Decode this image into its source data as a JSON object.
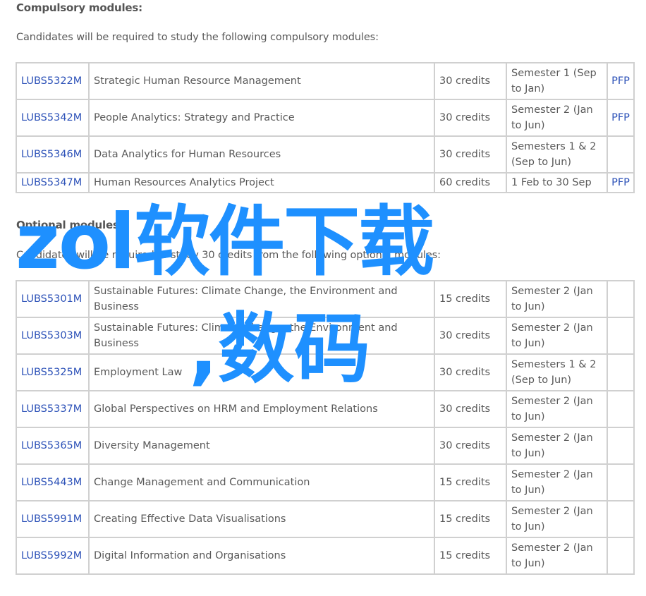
{
  "compulsory": {
    "heading": "Compulsory modules:",
    "intro": "Candidates will be required to study the following compulsory modules:",
    "rows": [
      {
        "code": "LUBS5322M",
        "title": "Strategic Human Resource Management",
        "credits": "30 credits",
        "semester": "Semester 1 (Sep to Jan)",
        "pfp": "PFP"
      },
      {
        "code": "LUBS5342M",
        "title": "People Analytics: Strategy and Practice",
        "credits": "30 credits",
        "semester": "Semester 2 (Jan to Jun)",
        "pfp": "PFP"
      },
      {
        "code": "LUBS5346M",
        "title": "Data Analytics for Human Resources",
        "credits": "30 credits",
        "semester": "Semesters 1 & 2 (Sep to Jun)",
        "pfp": ""
      },
      {
        "code": "LUBS5347M",
        "title": "Human Resources Analytics Project",
        "credits": "60 credits",
        "semester": "1 Feb to 30 Sep",
        "pfp": "PFP"
      }
    ]
  },
  "optional": {
    "heading": "Optional modules:",
    "intro": "Candidates will be required to study 30 credits from the following optional modules:",
    "rows": [
      {
        "code": "LUBS5301M",
        "title": "Sustainable Futures: Climate Change, the Environment and Business",
        "credits": "15 credits",
        "semester": "Semester 2 (Jan to Jun)",
        "pfp": ""
      },
      {
        "code": "LUBS5303M",
        "title": "Sustainable Futures: Climate Change, the Environment and Business",
        "credits": "30 credits",
        "semester": "Semester 2 (Jan to Jun)",
        "pfp": ""
      },
      {
        "code": "LUBS5325M",
        "title": "Employment Law",
        "credits": "30 credits",
        "semester": "Semesters 1 & 2 (Sep to Jun)",
        "pfp": ""
      },
      {
        "code": "LUBS5337M",
        "title": "Global Perspectives on HRM and Employment Relations",
        "credits": "30 credits",
        "semester": "Semester 2 (Jan to Jun)",
        "pfp": ""
      },
      {
        "code": "LUBS5365M",
        "title": "Diversity Management",
        "credits": "30 credits",
        "semester": "Semester 2 (Jan to Jun)",
        "pfp": ""
      },
      {
        "code": "LUBS5443M",
        "title": "Change Management and Communication",
        "credits": "15 credits",
        "semester": "Semester 2 (Jan to Jun)",
        "pfp": ""
      },
      {
        "code": "LUBS5991M",
        "title": "Creating Effective Data Visualisations",
        "credits": "15 credits",
        "semester": "Semester 2 (Jan to Jun)",
        "pfp": ""
      },
      {
        "code": "LUBS5992M",
        "title": "Digital Information and Organisations",
        "credits": "15 credits",
        "semester": "Semester 2 (Jan to Jun)",
        "pfp": ""
      }
    ]
  },
  "watermark": {
    "line1": "zol软件下载",
    "line2": ",数码"
  },
  "colors": {
    "text": "#595959",
    "link": "#2d52b8",
    "border": "#d0d0d0",
    "watermark": "#1e90ff"
  }
}
